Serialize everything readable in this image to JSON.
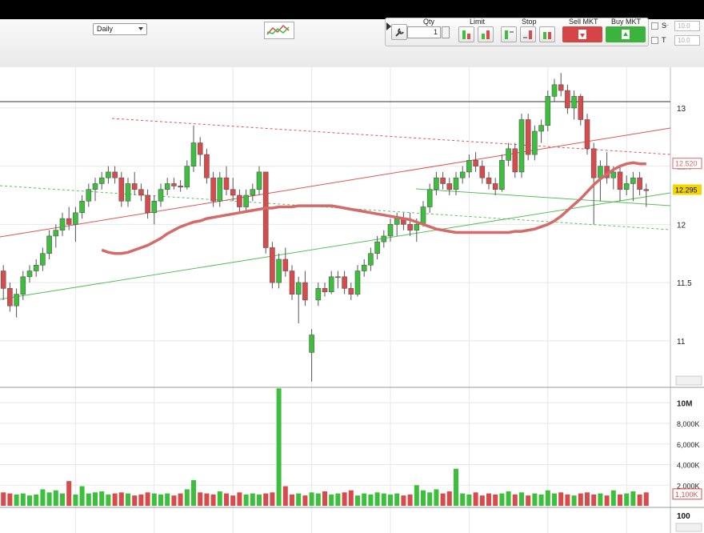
{
  "toolbar": {
    "interval": "Daily",
    "qty_label": "Qty",
    "qty_value": "1",
    "limit_label": "Limit",
    "stop_label": "Stop",
    "sell_label": "Sell MKT",
    "buy_label": "Buy MKT",
    "s_label": "S",
    "t_label": "T",
    "s_value": "10.0",
    "t_value": "10.0",
    "window_controls": "– ⧉ ✕"
  },
  "colors": {
    "up": "#3cc03c",
    "down": "#d94b4b",
    "ma": "#d46a6a",
    "grid": "#e7e7e7"
  },
  "price_panel": {
    "ticks": [
      "13",
      "12.5",
      "12",
      "11.5",
      "11"
    ],
    "tick_values": [
      13,
      12.5,
      12,
      11.5,
      11
    ],
    "ylim": [
      10.6,
      13.35
    ],
    "last_price_tag": "12.295",
    "last_price_value": 12.295,
    "ma_tag": "12.520",
    "ma_value": 12.52
  },
  "volume_panel": {
    "ticks": [
      "10M",
      "8,000K",
      "6,000K",
      "4,000K",
      "2,000K"
    ],
    "tick_values": [
      10000000,
      8000000,
      6000000,
      4000000,
      2000000
    ],
    "ylim": [
      0,
      11500000
    ],
    "last_volume_tag": "1,100K",
    "last_volume_value": 1100000
  },
  "lower_panel": {
    "tick": "100"
  },
  "chart_data": {
    "type": "candlestick",
    "series": [
      {
        "name": "Price",
        "ohlc": [
          [
            11.75,
            11.8,
            11.55,
            11.6
          ],
          [
            11.6,
            11.65,
            11.35,
            11.45
          ],
          [
            11.45,
            11.5,
            11.25,
            11.3
          ],
          [
            11.3,
            11.45,
            11.2,
            11.4
          ],
          [
            11.4,
            11.6,
            11.35,
            11.55
          ],
          [
            11.55,
            11.65,
            11.5,
            11.6
          ],
          [
            11.6,
            11.7,
            11.55,
            11.65
          ],
          [
            11.65,
            11.8,
            11.6,
            11.75
          ],
          [
            11.75,
            11.95,
            11.7,
            11.9
          ],
          [
            11.9,
            12.0,
            11.8,
            11.95
          ],
          [
            11.95,
            12.1,
            11.9,
            12.05
          ],
          [
            12.05,
            12.15,
            11.95,
            12.0
          ],
          [
            12.0,
            12.15,
            11.85,
            12.1
          ],
          [
            12.1,
            12.25,
            12.05,
            12.2
          ],
          [
            12.2,
            12.35,
            12.15,
            12.3
          ],
          [
            12.3,
            12.4,
            12.2,
            12.35
          ],
          [
            12.35,
            12.45,
            12.3,
            12.4
          ],
          [
            12.4,
            12.5,
            12.35,
            12.45
          ],
          [
            12.45,
            12.5,
            12.35,
            12.4
          ],
          [
            12.4,
            12.45,
            12.15,
            12.2
          ],
          [
            12.2,
            12.4,
            12.15,
            12.35
          ],
          [
            12.35,
            12.45,
            12.25,
            12.3
          ],
          [
            12.3,
            12.35,
            12.2,
            12.25
          ],
          [
            12.25,
            12.3,
            12.05,
            12.1
          ],
          [
            12.1,
            12.25,
            12.0,
            12.2
          ],
          [
            12.2,
            12.35,
            12.15,
            12.3
          ],
          [
            12.3,
            12.4,
            12.25,
            12.35
          ],
          [
            12.35,
            12.4,
            12.3,
            12.33
          ],
          [
            12.33,
            12.38,
            12.28,
            12.32
          ],
          [
            12.32,
            12.55,
            12.3,
            12.5
          ],
          [
            12.5,
            12.85,
            12.45,
            12.7
          ],
          [
            12.7,
            12.75,
            12.5,
            12.6
          ],
          [
            12.6,
            12.65,
            12.35,
            12.4
          ],
          [
            12.4,
            12.45,
            12.15,
            12.2
          ],
          [
            12.2,
            12.45,
            12.15,
            12.4
          ],
          [
            12.4,
            12.5,
            12.25,
            12.3
          ],
          [
            12.3,
            12.4,
            12.2,
            12.25
          ],
          [
            12.25,
            12.3,
            12.1,
            12.15
          ],
          [
            12.15,
            12.3,
            12.1,
            12.25
          ],
          [
            12.25,
            12.35,
            12.2,
            12.3
          ],
          [
            12.3,
            12.5,
            12.25,
            12.45
          ],
          [
            12.45,
            12.45,
            11.75,
            11.8
          ],
          [
            11.8,
            11.85,
            11.45,
            11.5
          ],
          [
            11.5,
            11.75,
            11.45,
            11.7
          ],
          [
            11.7,
            11.8,
            11.55,
            11.6
          ],
          [
            11.6,
            11.65,
            11.35,
            11.4
          ],
          [
            11.4,
            11.55,
            11.15,
            11.5
          ],
          [
            11.5,
            11.6,
            11.3,
            11.35
          ],
          [
            10.9,
            11.1,
            10.65,
            11.05
          ],
          [
            11.35,
            11.5,
            11.3,
            11.45
          ],
          [
            11.45,
            11.5,
            11.38,
            11.42
          ],
          [
            11.42,
            11.6,
            11.4,
            11.55
          ],
          [
            11.55,
            11.6,
            11.45,
            11.55
          ],
          [
            11.55,
            11.6,
            11.4,
            11.45
          ],
          [
            11.45,
            11.5,
            11.35,
            11.4
          ],
          [
            11.4,
            11.65,
            11.38,
            11.6
          ],
          [
            11.6,
            11.7,
            11.55,
            11.65
          ],
          [
            11.65,
            11.8,
            11.6,
            11.75
          ],
          [
            11.75,
            11.9,
            11.7,
            11.85
          ],
          [
            11.85,
            11.95,
            11.8,
            11.9
          ],
          [
            11.9,
            12.05,
            11.85,
            12.0
          ],
          [
            12.0,
            12.1,
            11.9,
            12.05
          ],
          [
            12.05,
            12.1,
            11.95,
            12.0
          ],
          [
            12.0,
            12.1,
            11.9,
            11.95
          ],
          [
            11.95,
            12.05,
            11.85,
            12.0
          ],
          [
            12.0,
            12.2,
            11.98,
            12.15
          ],
          [
            12.15,
            12.35,
            12.1,
            12.3
          ],
          [
            12.3,
            12.45,
            12.25,
            12.4
          ],
          [
            12.4,
            12.45,
            12.3,
            12.35
          ],
          [
            12.35,
            12.4,
            12.25,
            12.3
          ],
          [
            12.3,
            12.45,
            12.25,
            12.4
          ],
          [
            12.4,
            12.5,
            12.35,
            12.45
          ],
          [
            12.45,
            12.6,
            12.4,
            12.55
          ],
          [
            12.55,
            12.62,
            12.45,
            12.5
          ],
          [
            12.5,
            12.55,
            12.35,
            12.4
          ],
          [
            12.4,
            12.45,
            12.3,
            12.35
          ],
          [
            12.35,
            12.4,
            12.25,
            12.3
          ],
          [
            12.3,
            12.6,
            12.28,
            12.55
          ],
          [
            12.55,
            12.7,
            12.5,
            12.65
          ],
          [
            12.65,
            12.7,
            12.4,
            12.45
          ],
          [
            12.45,
            12.95,
            12.4,
            12.9
          ],
          [
            12.9,
            12.95,
            12.55,
            12.6
          ],
          [
            12.6,
            12.85,
            12.55,
            12.8
          ],
          [
            12.8,
            12.9,
            12.7,
            12.85
          ],
          [
            12.85,
            13.15,
            12.8,
            13.1
          ],
          [
            13.1,
            13.25,
            13.05,
            13.2
          ],
          [
            13.2,
            13.3,
            13.1,
            13.15
          ],
          [
            13.15,
            13.2,
            12.95,
            13.0
          ],
          [
            13.0,
            13.15,
            12.9,
            13.1
          ],
          [
            13.1,
            13.12,
            12.85,
            12.9
          ],
          [
            12.9,
            12.95,
            12.6,
            12.65
          ],
          [
            12.65,
            12.7,
            12.0,
            12.4
          ],
          [
            12.4,
            12.55,
            12.2,
            12.5
          ],
          [
            12.5,
            12.62,
            12.35,
            12.4
          ],
          [
            12.4,
            12.5,
            12.3,
            12.45
          ],
          [
            12.45,
            12.5,
            12.2,
            12.3
          ],
          [
            12.3,
            12.42,
            12.25,
            12.35
          ],
          [
            12.35,
            12.45,
            12.2,
            12.4
          ],
          [
            12.4,
            12.45,
            12.25,
            12.3
          ],
          [
            12.3,
            12.35,
            12.15,
            12.29
          ]
        ]
      },
      {
        "name": "Volume",
        "values": [
          1.4,
          1.3,
          1.2,
          1.1,
          1.2,
          1.0,
          1.1,
          1.6,
          1.3,
          1.5,
          1.2,
          2.4,
          1.1,
          1.9,
          1.2,
          1.3,
          1.4,
          1.1,
          1.2,
          1.3,
          1.2,
          1.0,
          1.1,
          1.3,
          1.2,
          1.1,
          1.2,
          1.0,
          1.2,
          1.6,
          2.5,
          1.3,
          1.2,
          1.1,
          1.4,
          1.2,
          1.0,
          1.3,
          1.1,
          1.2,
          1.1,
          1.2,
          1.3,
          11.4,
          1.9,
          1.1,
          1.2,
          1.0,
          1.3,
          1.2,
          1.4,
          1.1,
          1.2,
          1.3,
          1.5,
          1.0,
          1.2,
          1.1,
          1.3,
          1.2,
          1.1,
          1.2,
          1.0,
          1.1,
          2.0,
          1.5,
          1.3,
          1.6,
          1.2,
          1.4,
          3.6,
          1.2,
          1.1,
          1.3,
          1.0,
          1.2,
          1.1,
          1.2,
          1.4,
          1.1,
          1.3,
          1.0,
          1.2,
          1.1,
          1.5,
          1.2,
          1.3,
          1.1,
          1.0,
          1.2,
          1.3,
          1.1,
          1.2,
          1.0,
          1.5,
          1.1,
          1.2,
          1.4,
          1.1,
          1.3
        ]
      }
    ],
    "xlim": [
      0,
      100
    ],
    "ma_values": [
      11.78,
      11.76,
      11.75,
      11.75,
      11.76,
      11.78,
      11.8,
      11.82,
      11.85,
      11.88,
      11.92,
      11.95,
      11.98,
      12.0,
      12.02,
      12.03,
      12.05,
      12.06,
      12.07,
      12.08,
      12.09,
      12.1,
      12.11,
      12.12,
      12.13,
      12.14,
      12.14,
      12.15,
      12.15,
      12.15,
      12.16,
      12.16,
      12.16,
      12.16,
      12.16,
      12.16,
      12.15,
      12.14,
      12.13,
      12.12,
      12.11,
      12.1,
      12.09,
      12.08,
      12.07,
      12.06,
      12.05,
      12.04,
      12.02,
      12.0,
      11.98,
      11.96,
      11.95,
      11.94,
      11.93,
      11.93,
      11.93,
      11.93,
      11.93,
      11.93,
      11.93,
      11.93,
      11.93,
      11.94,
      11.94,
      11.95,
      11.96,
      11.98,
      12.0,
      12.03,
      12.07,
      12.12,
      12.17,
      12.22,
      12.28,
      12.34,
      12.39,
      12.43,
      12.47,
      12.5,
      12.52,
      12.53,
      12.52,
      12.52
    ]
  }
}
